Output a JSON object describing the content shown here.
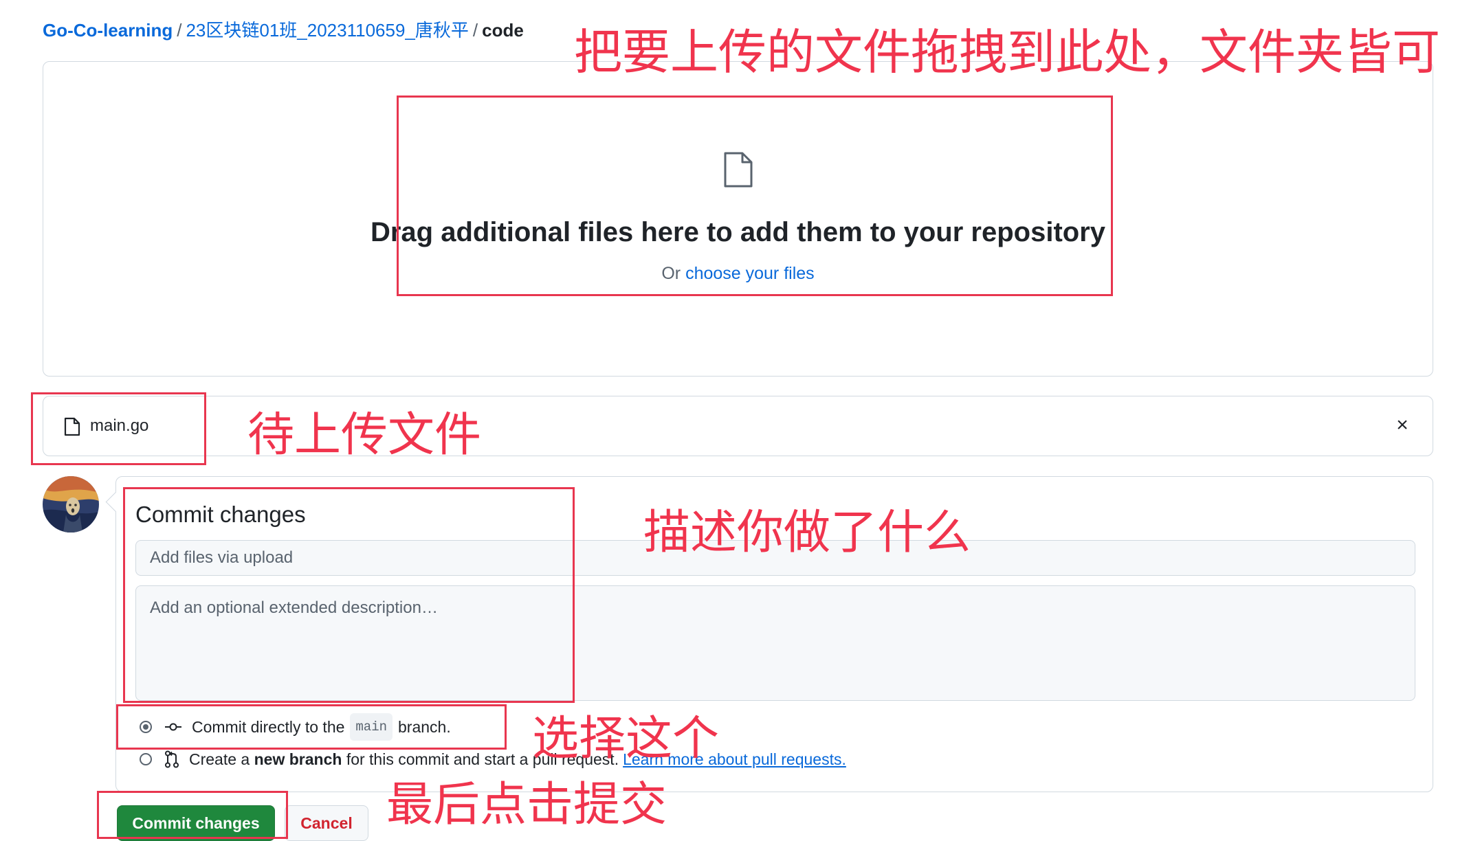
{
  "breadcrumb": {
    "owner": "Go-Co-learning",
    "repo": "23区块链01班_2023110659_唐秋平",
    "folder": "code",
    "separator": "/"
  },
  "dropzone": {
    "icon": "file-icon",
    "title": "Drag additional files here to add them to your repository",
    "or_text": "Or",
    "choose_link": "choose your files"
  },
  "pending_files": {
    "items": [
      {
        "name": "main.go",
        "icon": "file-icon"
      }
    ],
    "remove_icon": "×"
  },
  "commit": {
    "title": "Commit changes",
    "summary_placeholder": "Add files via upload",
    "description_placeholder": "Add an optional extended description…",
    "option_direct": {
      "prefix": "Commit directly to the",
      "branch": "main",
      "suffix": "branch.",
      "selected": true
    },
    "option_new_branch": {
      "prefix": "Create a",
      "bold": "new branch",
      "suffix": "for this commit and start a pull request.",
      "link": "Learn more about pull requests.",
      "selected": false
    },
    "commit_button": "Commit changes",
    "cancel_button": "Cancel"
  },
  "annotations": {
    "drag_here": "把要上传的文件拖拽到此处，文件夹皆可",
    "pending": "待上传文件",
    "describe": "描述你做了什么",
    "choose_this": "选择这个",
    "finally_submit": "最后点击提交",
    "color": "#f0344d"
  },
  "colors": {
    "link": "#0969da",
    "primary_button": "#1f883d",
    "danger_text": "#d1242f",
    "border": "#d1d9e0"
  }
}
